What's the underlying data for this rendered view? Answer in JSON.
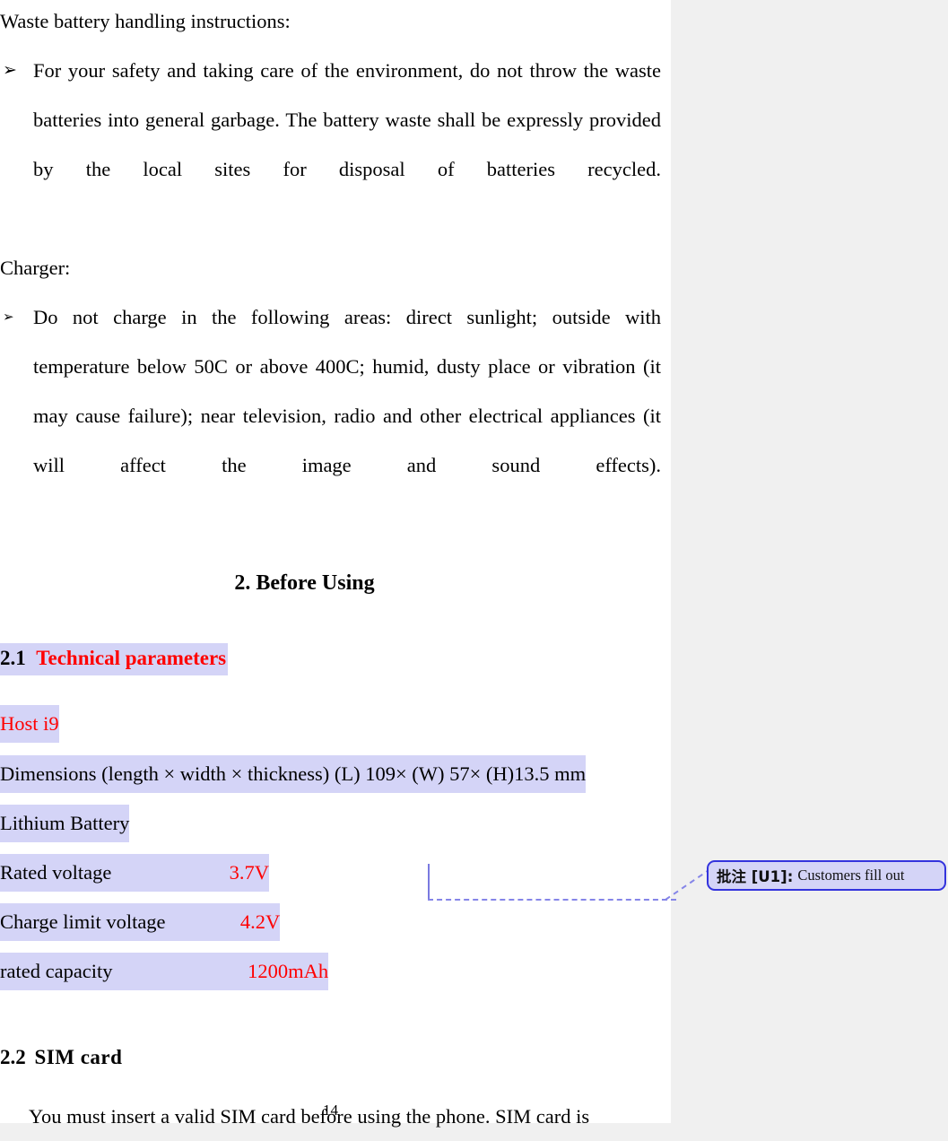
{
  "page": {
    "number": "14",
    "background_color": "#ffffff",
    "margin_color": "#f0f0f0"
  },
  "colors": {
    "highlight": "#d4d4f7",
    "accent_red": "#ff0000",
    "comment_border": "#3333dd",
    "leader_line": "#8585e8"
  },
  "content": {
    "intro_heading": "Waste battery handling instructions:",
    "bullets": [
      {
        "glyph": "➢",
        "text": "For your safety and taking care of the environment, do not throw the waste batteries into general garbage. The battery waste shall be expressly provided by the local sites for disposal of batteries recycled."
      },
      {
        "glyph": "➢",
        "text": "Do not charge in the following areas: direct sunlight; outside with temperature below 50C or above 400C; humid, dusty place or vibration (it may cause failure); near television, radio and other electrical appliances (it will affect the image and sound effects)."
      }
    ],
    "charger_heading": "Charger:",
    "chapter_heading": "2. Before Using",
    "section_2_1": {
      "number": "2.1",
      "title": "Technical parameters"
    },
    "spec_table": {
      "host_label": "Host i9",
      "rows": [
        {
          "label": "Dimensions (length × width × thickness) (L) 109× (W) 57× (H)13.5 mm",
          "value": ""
        },
        {
          "label": "Lithium Battery",
          "value": ""
        },
        {
          "label": "Rated voltage",
          "value": "3.7V"
        },
        {
          "label": "Charge limit voltage",
          "value": "4.2V"
        },
        {
          "label": "rated capacity",
          "value": "1200mAh"
        }
      ]
    },
    "section_2_2": {
      "number": "2.2",
      "title": "SIM card"
    },
    "sim_paragraph": "You must insert a valid SIM card before using the phone. SIM card is"
  },
  "comment": {
    "label": "批注 [U1]:",
    "text": "Customers fill out"
  }
}
